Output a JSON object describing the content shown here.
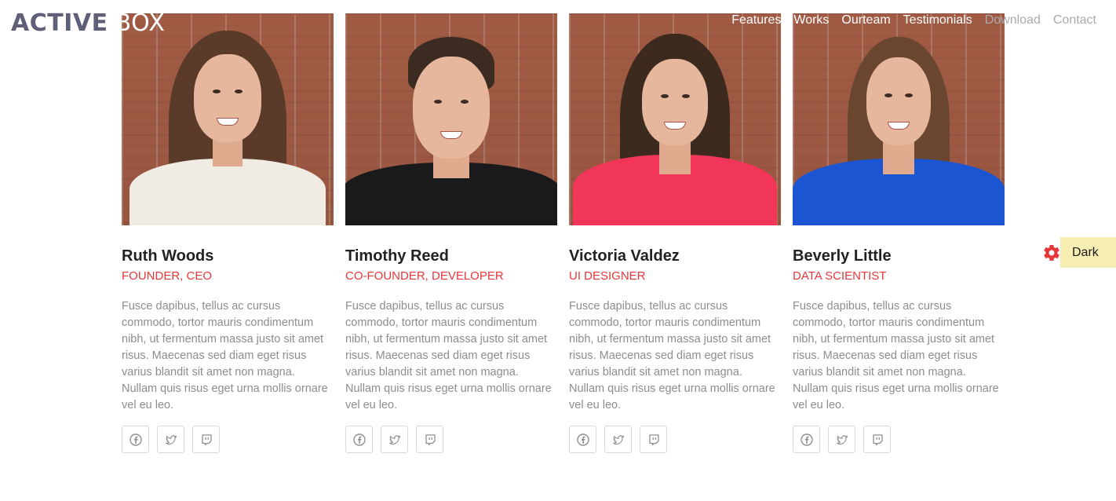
{
  "brand": {
    "strong": "ACTIVE",
    "light": "BOX"
  },
  "nav": {
    "items": [
      {
        "label": "Features"
      },
      {
        "label": "Works"
      },
      {
        "label": "Ourteam"
      },
      {
        "label": "Testimonials"
      },
      {
        "label": "Download"
      },
      {
        "label": "Contact"
      }
    ]
  },
  "team": {
    "members": [
      {
        "name": "Ruth Woods",
        "role": "FOUNDER, CEO",
        "bio": "Fusce dapibus, tellus ac cursus commodo, tortor mauris condimentum nibh, ut fermentum massa justo sit amet risus. Maecenas sed diam eget risus varius blandit sit amet non magna. Nullam quis risus eget urna mollis ornare vel eu leo."
      },
      {
        "name": "Timothy Reed",
        "role": "CO-FOUNDER, DEVELOPER",
        "bio": "Fusce dapibus, tellus ac cursus commodo, tortor mauris condimentum nibh, ut fermentum massa justo sit amet risus. Maecenas sed diam eget risus varius blandit sit amet non magna. Nullam quis risus eget urna mollis ornare vel eu leo."
      },
      {
        "name": "Victoria Valdez",
        "role": "UI DESIGNER",
        "bio": "Fusce dapibus, tellus ac cursus commodo, tortor mauris condimentum nibh, ut fermentum massa justo sit amet risus. Maecenas sed diam eget risus varius blandit sit amet non magna. Nullam quis risus eget urna mollis ornare vel eu leo."
      },
      {
        "name": "Beverly Little",
        "role": "DATA SCIENTIST",
        "bio": "Fusce dapibus, tellus ac cursus commodo, tortor mauris condimentum nibh, ut fermentum massa justo sit amet risus. Maecenas sed diam eget risus varius blandit sit amet non magna. Nullam quis risus eget urna mollis ornare vel eu leo."
      }
    ],
    "social_icons": [
      "facebook-icon",
      "twitter-icon",
      "twitch-icon"
    ]
  },
  "theme_toggle": {
    "label": "Dark",
    "icon": "gear-icon"
  },
  "colors": {
    "accent": "#e8373a",
    "logo": "#5f5f78",
    "toggle_bg": "#f6edb3",
    "body_text": "#8d8d8d"
  }
}
